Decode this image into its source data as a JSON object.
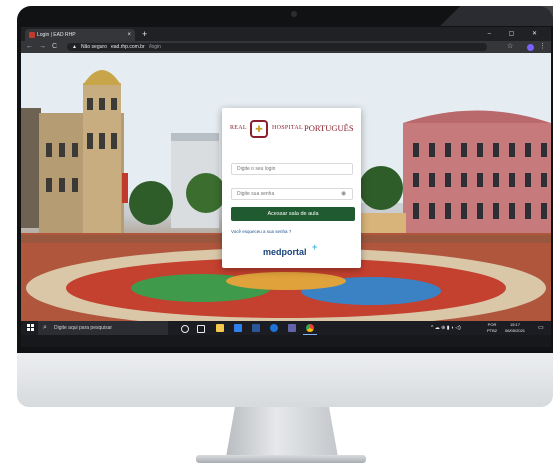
{
  "browser": {
    "tab_title": "Login | EAD RHP",
    "tab_close": "×",
    "new_tab": "+",
    "window_controls": "–  ▢  ✕",
    "nav": {
      "back": "←",
      "forward": "→",
      "reload": "C"
    },
    "url": {
      "lock": "▲",
      "security": "Não seguro",
      "domain": "ead.rhp.com.br",
      "path": "/login"
    },
    "star": "☆",
    "menu": "⋮"
  },
  "login": {
    "logo_left": "REAL",
    "logo_right": "HOSPITAL",
    "logo_name": "PORTUGUÊS",
    "crest": "✚",
    "login_placeholder": "Digite o seu login",
    "password_placeholder": "Digite sua senha",
    "eye": "◉",
    "submit_label": "Acessar sala de aula",
    "forgot_label": "Você esqueceu a sua senha ?",
    "brand_name": "medportal",
    "brand_plus": "+"
  },
  "taskbar": {
    "search_icon": "⌕",
    "search_placeholder": "Digite aqui para pesquisar",
    "tray": "^ ☁ ⊕ ▮ ◖ ◁)",
    "lang_line1": "POR",
    "lang_line2": "PTB2",
    "time": "15:17",
    "date": "06/05/2021",
    "notification": "▭"
  },
  "colors": {
    "brand_red": "#8b1e2d",
    "button_green": "#1f5a31",
    "medportal_blue": "#17427a",
    "medportal_cyan": "#49b7d6"
  },
  "icons": [
    "search-icon",
    "lock-icon",
    "star-icon",
    "eye-icon",
    "windows-icon",
    "task-view-icon",
    "file-explorer-icon",
    "mail-icon",
    "word-icon",
    "teams-icon",
    "chrome-icon",
    "notification-icon"
  ]
}
